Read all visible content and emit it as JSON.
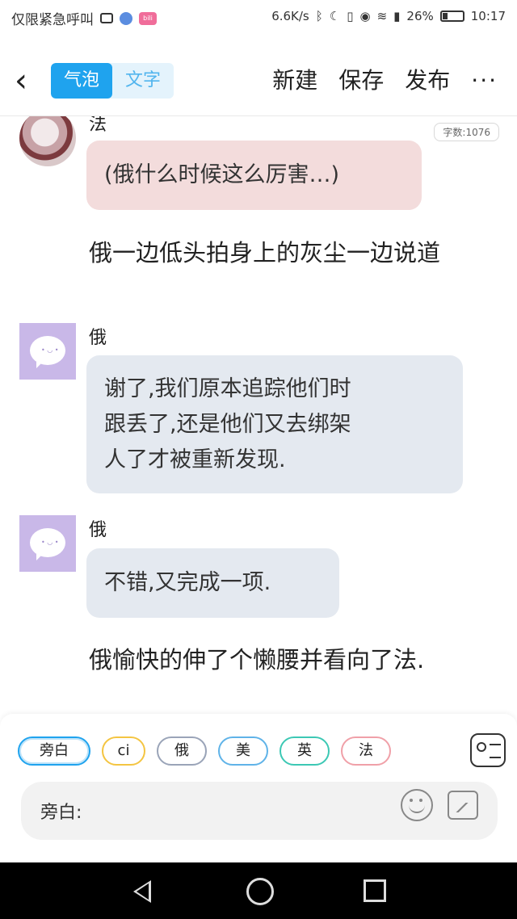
{
  "statusbar": {
    "left_text": "仅限紧急呼叫",
    "net_speed": "6.6K/s",
    "battery": "26%",
    "time": "10:17"
  },
  "header": {
    "back_icon": "chevron-left-icon",
    "tabs": [
      {
        "label": "气泡",
        "active": true
      },
      {
        "label": "文字",
        "active": false
      }
    ],
    "actions": [
      "新建",
      "保存",
      "发布"
    ],
    "more": "···",
    "accent_color": "#1fa3ee"
  },
  "chat": {
    "word_count": "字数:1076",
    "messages": [
      {
        "type": "bubble",
        "speaker": "法",
        "text": "(俄什么时候这么厉害…)",
        "color": "#f3dcdc"
      },
      {
        "type": "narration",
        "text": "俄一边低头拍身上的灰尘一边说道"
      },
      {
        "type": "bubble",
        "speaker": "俄",
        "lines": [
          "谢了,我们原本追踪他们时",
          "跟丢了,还是他们又去绑架",
          "人了才被重新发现."
        ],
        "color": "#e4e9f0"
      },
      {
        "type": "bubble",
        "speaker": "俄",
        "text": "不错,又完成一项.",
        "color": "#e4e9f0"
      },
      {
        "type": "narration",
        "text": "俄愉快的伸了个懒腰并看向了法."
      }
    ]
  },
  "panel": {
    "chips": [
      {
        "label": "旁白",
        "color": "#1fa3ee",
        "selected": true
      },
      {
        "label": "ci",
        "color": "#f4c542",
        "selected": false
      },
      {
        "label": "俄",
        "color": "#9aa4b8",
        "selected": false
      },
      {
        "label": "美",
        "color": "#5fb3e8",
        "selected": false
      },
      {
        "label": "英",
        "color": "#3cc8b4",
        "selected": false
      },
      {
        "label": "法",
        "color": "#f0a0a8",
        "selected": false
      }
    ],
    "input_label": "旁白:"
  }
}
